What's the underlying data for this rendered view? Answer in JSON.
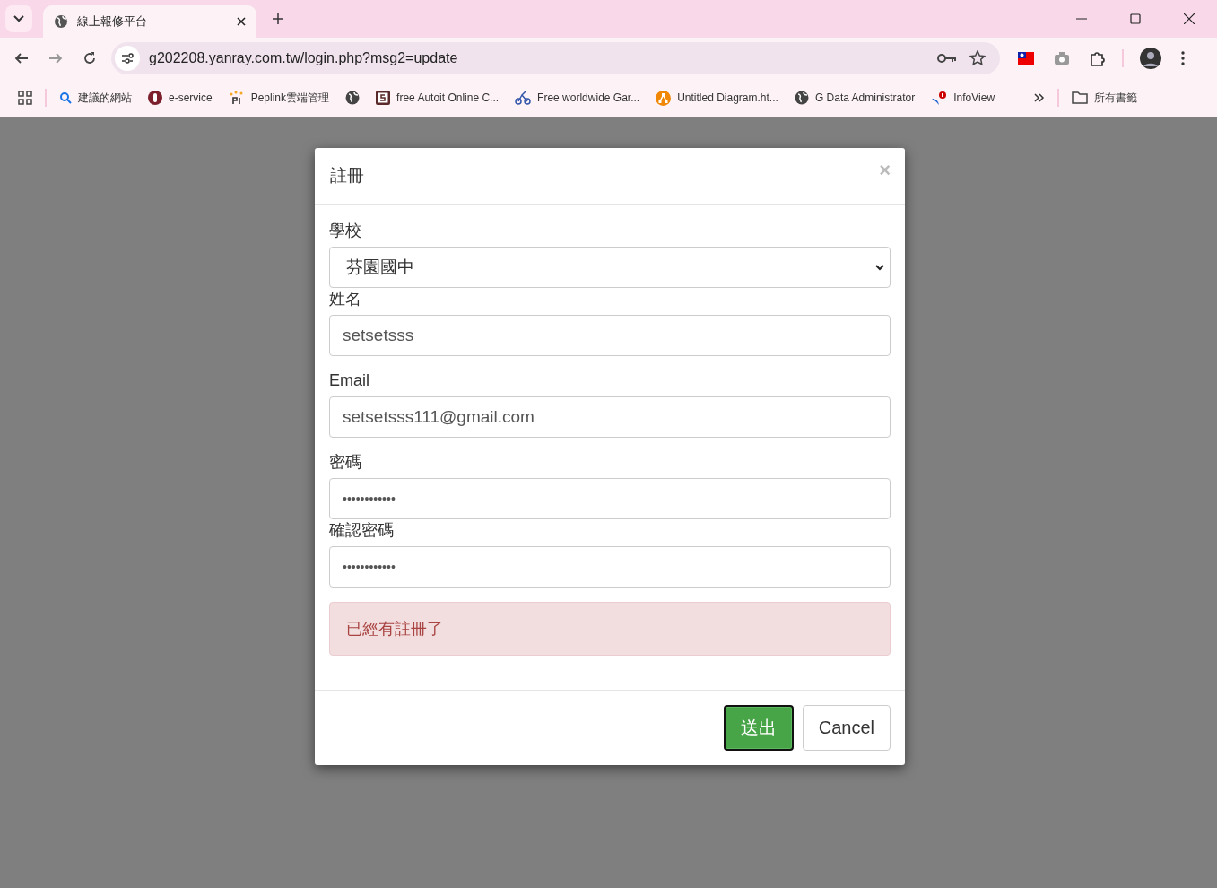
{
  "browser": {
    "tab": {
      "title": "線上報修平台",
      "selected": true
    },
    "address": {
      "url": "g202208.yanray.com.tw/login.php?msg2=update"
    },
    "bookmarks": [
      {
        "label": "建議的網站",
        "kind": "search"
      },
      {
        "label": "e-service",
        "kind": "eservice"
      },
      {
        "label": "Peplink雲端管理",
        "kind": "peplink"
      },
      {
        "kind": "globe"
      },
      {
        "label": "free Autoit Online C...",
        "kind": "autoit"
      },
      {
        "label": "Free worldwide Gar...",
        "kind": "bike"
      },
      {
        "label": "Untitled Diagram.ht...",
        "kind": "diagram"
      },
      {
        "label": "G Data Administrator",
        "kind": "globe"
      },
      {
        "label": "InfoView",
        "kind": "infoview"
      }
    ],
    "all_bookmarks": "所有書籤"
  },
  "modal": {
    "title": "註冊",
    "close": "×",
    "fields": [
      {
        "kind": "select",
        "label": "學校",
        "value": "芬園國中"
      },
      {
        "kind": "text",
        "label": "姓名",
        "value": "setsetsss"
      },
      {
        "kind": "text",
        "label": "Email",
        "value": "setsetsss111@gmail.com"
      },
      {
        "kind": "password",
        "label": "密碼",
        "value": "••••••••••••"
      },
      {
        "kind": "password",
        "label": "確認密碼",
        "value": "••••••••••••"
      }
    ],
    "alert": "已經有註冊了",
    "buttons": [
      {
        "label": "送出",
        "kind": "primary",
        "focused": true
      },
      {
        "label": "Cancel",
        "kind": "default",
        "focused": false
      }
    ]
  }
}
